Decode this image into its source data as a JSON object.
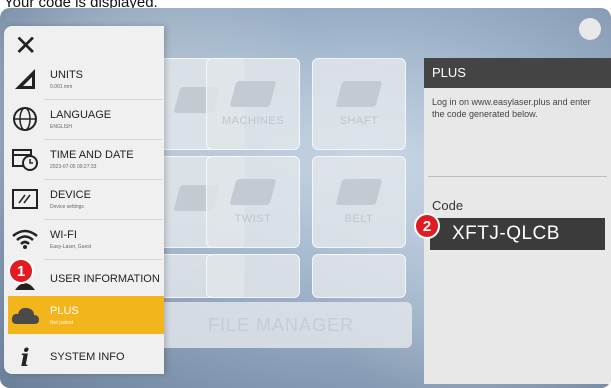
{
  "caption": "Your code is displayed.",
  "menu": {
    "items": [
      {
        "label": "UNITS",
        "sub": "0.001 mm",
        "icon": "ruler-triangle-icon"
      },
      {
        "label": "LANGUAGE",
        "sub": "ENGLISH",
        "icon": "globe-icon"
      },
      {
        "label": "TIME AND DATE",
        "sub": "2023-07-05 09:27:33",
        "icon": "calendar-clock-icon"
      },
      {
        "label": "DEVICE",
        "sub": "Device settings",
        "icon": "device-icon"
      },
      {
        "label": "WI-FI",
        "sub": "Easy-Laser, Guest",
        "icon": "wifi-icon"
      },
      {
        "label": "USER INFORMATION",
        "sub": "",
        "icon": "user-icon"
      },
      {
        "label": "PLUS",
        "sub": "Not paired",
        "icon": "cloud-icon"
      },
      {
        "label": "SYSTEM INFO",
        "sub": "",
        "icon": "info-icon"
      }
    ]
  },
  "background_tiles": [
    "MACHINES",
    "SHAFT",
    "TWIST",
    "BELT",
    "FILE MANAGER"
  ],
  "panel": {
    "title": "PLUS",
    "text": "Log in on www.easylaser.plus and enter the code generated below.",
    "code_label": "Code",
    "code_value": "XFTJ-QLCB"
  },
  "markers": [
    "1",
    "2"
  ],
  "colors": {
    "active": "#f2b51c",
    "marker": "#e01b22",
    "panel_header": "#444444"
  }
}
